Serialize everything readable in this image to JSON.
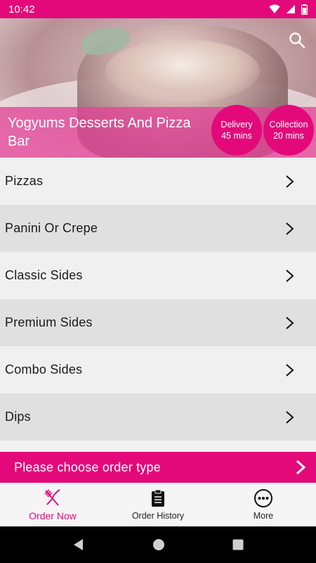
{
  "status_bar": {
    "time": "10:42"
  },
  "header": {
    "restaurant_name": "Yogyums Desserts And Pizza Bar",
    "delivery": {
      "label": "Delivery",
      "time": "45 mins"
    },
    "collection": {
      "label": "Collection",
      "time": "20 mins"
    }
  },
  "menu": {
    "categories": [
      {
        "label": "Pizzas"
      },
      {
        "label": "Panini Or Crepe"
      },
      {
        "label": "Classic Sides"
      },
      {
        "label": "Premium Sides"
      },
      {
        "label": "Combo Sides"
      },
      {
        "label": "Dips"
      }
    ]
  },
  "order_type_bar": {
    "label": "Please choose order type"
  },
  "bottom_nav": {
    "items": [
      {
        "label": "Order Now",
        "icon": "fork-knife-icon",
        "active": true
      },
      {
        "label": "Order History",
        "icon": "clipboard-icon",
        "active": false
      },
      {
        "label": "More",
        "icon": "more-dots-icon",
        "active": false
      }
    ]
  },
  "colors": {
    "brand": "#e3097a",
    "row_light": "#f0f0f0",
    "row_dark": "#e0e0e0"
  }
}
